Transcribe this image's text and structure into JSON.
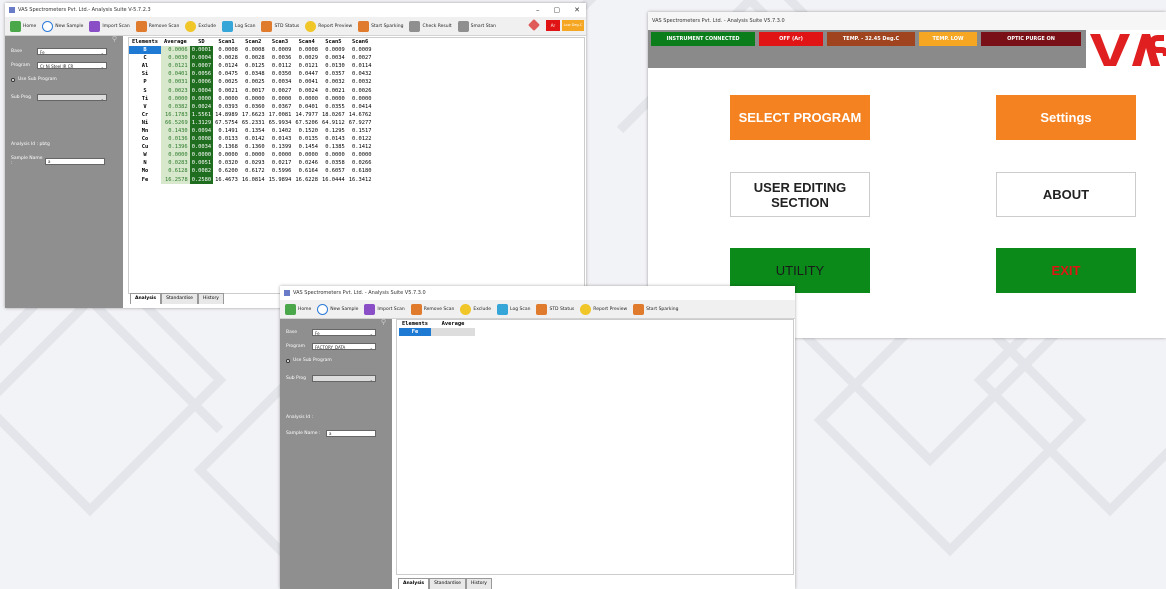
{
  "colors": {
    "green_btn": "#0b8a1a",
    "orange_btn": "#f58220",
    "red_status": "#e01414",
    "brown_status": "#a0441f",
    "maroon_status": "#7a1017",
    "selected_row": "#1f7ad4",
    "sd_cell": "#1f6e1f",
    "exit_text": "#e01414",
    "logo_red": "#e02020",
    "sidebar_bg": "#8f8f8f"
  },
  "win1": {
    "title": "VAS Spectrometers Pvt. Ltd.- Analysis Suite V-5.7.2.3",
    "controls": [
      "–",
      "▢",
      "✕"
    ],
    "toolbar": [
      {
        "label": "Home",
        "icon": "home-icon"
      },
      {
        "label": "New Sample",
        "icon": "new-sample-icon"
      },
      {
        "label": "Import Scan",
        "icon": "import-scan-icon"
      },
      {
        "label": "Remove Scan",
        "icon": "remove-scan-icon"
      },
      {
        "label": "Exclude",
        "icon": "exclude-icon"
      },
      {
        "label": "Log Scan",
        "icon": "log-scan-icon"
      },
      {
        "label": "STD Status",
        "icon": "std-status-icon"
      },
      {
        "label": "Report Preview",
        "icon": "report-preview-icon"
      },
      {
        "label": "Start Sparking",
        "icon": "start-sparking-icon"
      },
      {
        "label": "Check Result",
        "icon": "check-result-icon"
      },
      {
        "label": "Smart Stan",
        "icon": "smart-stan-icon"
      }
    ],
    "badge_ar": "Ar",
    "badge_temp": "Low Deg.C",
    "sidebar": {
      "base_label": "Base",
      "base_value": "Fe",
      "program_label": "Program",
      "program_value": "Cr Ni Steel IR CR",
      "use_sub_label": "Use Sub Program",
      "sub_prog_label": "Sub Prog",
      "sub_prog_value": "",
      "analysis_id": "Analysis Id : pbtg",
      "sample_name_label": "Sample Name :",
      "sample_name_value": "a"
    },
    "table": {
      "headers": [
        "Elements",
        "Average",
        "SD",
        "Scan1",
        "Scan2",
        "Scan3",
        "Scan4",
        "Scan5",
        "Scan6"
      ],
      "rows": [
        [
          "B",
          "0.0006",
          "0.0001",
          "0.0008",
          "0.0008",
          "0.0009",
          "0.0008",
          "0.0009",
          "0.0009"
        ],
        [
          "C",
          "0.0030",
          "0.0004",
          "0.0028",
          "0.0028",
          "0.0036",
          "0.0029",
          "0.0034",
          "0.0027"
        ],
        [
          "Al",
          "0.0121",
          "0.0007",
          "0.0124",
          "0.0125",
          "0.0112",
          "0.0121",
          "0.0130",
          "0.0114"
        ],
        [
          "Si",
          "0.0401",
          "0.0056",
          "0.0475",
          "0.0348",
          "0.0350",
          "0.0447",
          "0.0357",
          "0.0432"
        ],
        [
          "P",
          "0.0031",
          "0.0006",
          "0.0025",
          "0.0025",
          "0.0034",
          "0.0041",
          "0.0032",
          "0.0032"
        ],
        [
          "S",
          "0.0023",
          "0.0004",
          "0.0021",
          "0.0017",
          "0.0027",
          "0.0024",
          "0.0021",
          "0.0026"
        ],
        [
          "Ti",
          "0.0000",
          "0.0000",
          "0.0000",
          "0.0000",
          "0.0000",
          "0.0000",
          "0.0000",
          "0.0000"
        ],
        [
          "V",
          "0.0382",
          "0.0024",
          "0.0393",
          "0.0360",
          "0.0367",
          "0.0401",
          "0.0355",
          "0.0414"
        ],
        [
          "Cr",
          "16.1783",
          "1.5561",
          "14.8989",
          "17.6623",
          "17.0081",
          "14.7977",
          "18.0267",
          "14.6762"
        ],
        [
          "Ni",
          "66.5269",
          "1.3129",
          "67.5754",
          "65.2331",
          "65.9934",
          "67.5206",
          "64.9112",
          "67.9277"
        ],
        [
          "Mn",
          "0.1430",
          "0.0094",
          "0.1491",
          "0.1354",
          "0.1402",
          "0.1520",
          "0.1295",
          "0.1517"
        ],
        [
          "Co",
          "0.0136",
          "0.0008",
          "0.0133",
          "0.0142",
          "0.0143",
          "0.0135",
          "0.0143",
          "0.0122"
        ],
        [
          "Cu",
          "0.1396",
          "0.0034",
          "0.1368",
          "0.1360",
          "0.1399",
          "0.1454",
          "0.1385",
          "0.1412"
        ],
        [
          "W",
          "0.0000",
          "0.0000",
          "0.0000",
          "0.0000",
          "0.0000",
          "0.0000",
          "0.0000",
          "0.0000"
        ],
        [
          "N",
          "0.0283",
          "0.0051",
          "0.0320",
          "0.0293",
          "0.0217",
          "0.0246",
          "0.0358",
          "0.0266"
        ],
        [
          "Mo",
          "0.6128",
          "0.0082",
          "0.6200",
          "0.6172",
          "0.5996",
          "0.6164",
          "0.6057",
          "0.6180"
        ],
        [
          "Fe",
          "16.2578",
          "0.2580",
          "16.4673",
          "16.0814",
          "15.9894",
          "16.6228",
          "16.0444",
          "16.3412"
        ]
      ]
    },
    "tabs": [
      "Analysis",
      "Standardise",
      "History"
    ]
  },
  "win2": {
    "title": "VAS Spectrometers Pvt. Ltd. - Analysis Suite V5.7.3.0",
    "toolbar": [
      {
        "label": "Home",
        "icon": "home-icon"
      },
      {
        "label": "New Sample",
        "icon": "new-sample-icon"
      },
      {
        "label": "Import Scan",
        "icon": "import-scan-icon"
      },
      {
        "label": "Remove Scan",
        "icon": "remove-scan-icon"
      },
      {
        "label": "Exclude",
        "icon": "exclude-icon"
      },
      {
        "label": "Log Scan",
        "icon": "log-scan-icon"
      },
      {
        "label": "STD Status",
        "icon": "std-status-icon"
      },
      {
        "label": "Report Preview",
        "icon": "report-preview-icon"
      },
      {
        "label": "Start Sparking",
        "icon": "start-sparking-icon"
      }
    ],
    "sidebar": {
      "base_label": "Base",
      "base_value": "Fe",
      "program_label": "Program",
      "program_value": "FACTORY_DATA",
      "use_sub_label": "Use Sub Program",
      "sub_prog_label": "Sub Prog",
      "sub_prog_value": "",
      "analysis_id": "Analysis Id :",
      "sample_name_label": "Sample Name :",
      "sample_name_value": "a"
    },
    "table": {
      "headers": [
        "Elements",
        "Average"
      ],
      "rows": [
        [
          "Fe",
          ""
        ]
      ]
    },
    "tabs": [
      "Analysis",
      "Standardise",
      "History"
    ]
  },
  "win3": {
    "title": "VAS Spectrometers Pvt. Ltd. - Analysis Suite V5.7.3.0",
    "statuses": [
      {
        "label": "INSTRUMENT CONNECTED",
        "color": "#0b7d1a",
        "width": 104
      },
      {
        "label": "OFF (Ar)",
        "color": "#e01414",
        "width": 64
      },
      {
        "label": "TEMP. - 32.45 Deg.C",
        "color": "#a0441f",
        "width": 88
      },
      {
        "label": "TEMP. LOW",
        "color": "#f5a623",
        "width": 58
      },
      {
        "label": "OPTIC PURGE ON",
        "color": "#7a1017",
        "width": 100
      }
    ],
    "logo_text": "VAS",
    "buttons": {
      "select_program": "SELECT PROGRAM",
      "settings": "Settings",
      "user_editing": "USER EDITING SECTION",
      "about": "ABOUT",
      "utility": "UTILITY",
      "exit": "EXIT"
    }
  }
}
